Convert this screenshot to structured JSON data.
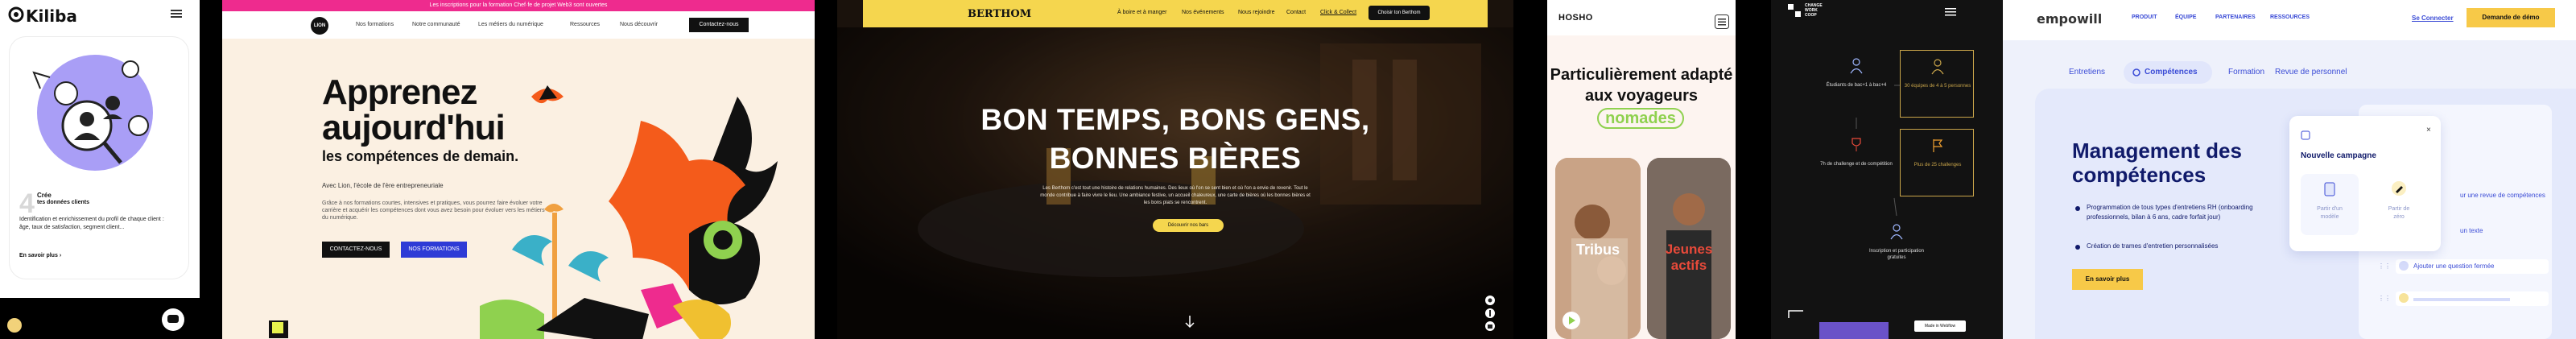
{
  "kiliba": {
    "logo": "Kiliba",
    "menu_icon": "hamburger-icon",
    "step_number": "4",
    "step_title": "Crée",
    "step_subtitle": "tes données clients",
    "body": "Identification et enrichissement du profil de chaque client : âge, taux de satisfaction, segment client...",
    "link": "En savoir plus",
    "accent": "#9a8ff5"
  },
  "lion": {
    "topbar": "Les inscriptions pour la formation Chef·fe de projet Web3 sont ouvertes",
    "logo": "LION",
    "nav": [
      "Nos formations",
      "Notre communauté",
      "Les métiers du numérique",
      "Ressources",
      "Nous découvrir"
    ],
    "cta": "Contactez-nous",
    "hero_line1": "Apprenez",
    "hero_line2": "aujourd'hui",
    "hero_line3": "les compétences de demain.",
    "kicker": "Avec Lion, l'école de l'ère entrepreneuriale",
    "paragraph": "Grâce à nos formations courtes, intensives et pratiques, vous pourrez faire évoluer votre carrière et acquérir les compétences dont vous avez besoin pour évoluer vers les métiers du numérique.",
    "btn_contact": "CONTACTEZ-NOUS",
    "btn_formations": "NOS FORMATIONS",
    "pink": "#ee2b8e",
    "orange": "#f45b1b",
    "blue": "#2e3bd6"
  },
  "berthom": {
    "logo": "BERTHOM",
    "nav": [
      "À boire et à manger",
      "Nos événements",
      "Nous rejoindre",
      "Contact",
      "Click & Collect"
    ],
    "cta": "Choisir ton Berthom",
    "headline1": "BON TEMPS, BONS GENS,",
    "headline2": "BONNES BIÈRES",
    "body": "Les Berthom c'est tout une histoire de relations humaines. Des lieux où l'on se sent bien et où l'on a envie de revenir. Tout le monde contribue à faire vivre le lieu. Une ambiance festive, un accueil chaleureux, une carte de bières où les bonnes bières et les bons plats se rencontrent.",
    "cta_center": "Découvrir nos bars",
    "yellow": "#f5d64e"
  },
  "hosho": {
    "logo": "HOSHO",
    "headline1": "Particulièrement adapté",
    "headline2": "aux voyageurs",
    "highlight": "nomades",
    "card1": "Tribus",
    "card2_line1": "Jeunes",
    "card2_line2": "actifs",
    "green": "#8fd14f",
    "red": "#e84a3a"
  },
  "grid": {
    "logo_line1": "CHANGE",
    "logo_line2": "WORK",
    "logo_line3": "COOP",
    "cell1": "Étudiants de bac+1 à bac+4",
    "cell2": "30 équipes de 4 à 5 personnes",
    "cell3": "7h de challenge et de compétition",
    "cell4": "Plus de 25 challenges",
    "cell5": "Inscription et participation gratuites",
    "badge": "Made in Webflow",
    "gold": "#c9a54a"
  },
  "empowill": {
    "logo": "empowill",
    "nav": [
      "PRODUIT",
      "ÉQUIPE",
      "PARTENAIRES",
      "RESSOURCES"
    ],
    "login": "Se Connecter",
    "demo": "Demande de démo",
    "tabs": [
      "Entretiens",
      "Compétences",
      "Formation",
      "Revue de personnel"
    ],
    "title_line1": "Management des",
    "title_line2": "compétences",
    "bullet1": "Programmation de tous types d'entretiens RH (onboarding professionnels, bilan à 6 ans, cadre forfait jour)",
    "bullet2": "Création de trames d'entretien personnalisées",
    "cta": "En savoir plus",
    "modal_title": "Nouvelle campagne",
    "opt1_line1": "Partir d'un",
    "opt1_line2": "modèle",
    "opt2_line1": "Partir de",
    "opt2_line2": "zéro",
    "list1": "ur une revue de compétences",
    "list2": "un texte",
    "list3": "Ajouter une question fermée",
    "yellow": "#f7c948",
    "blue": "#3a4bd6"
  }
}
